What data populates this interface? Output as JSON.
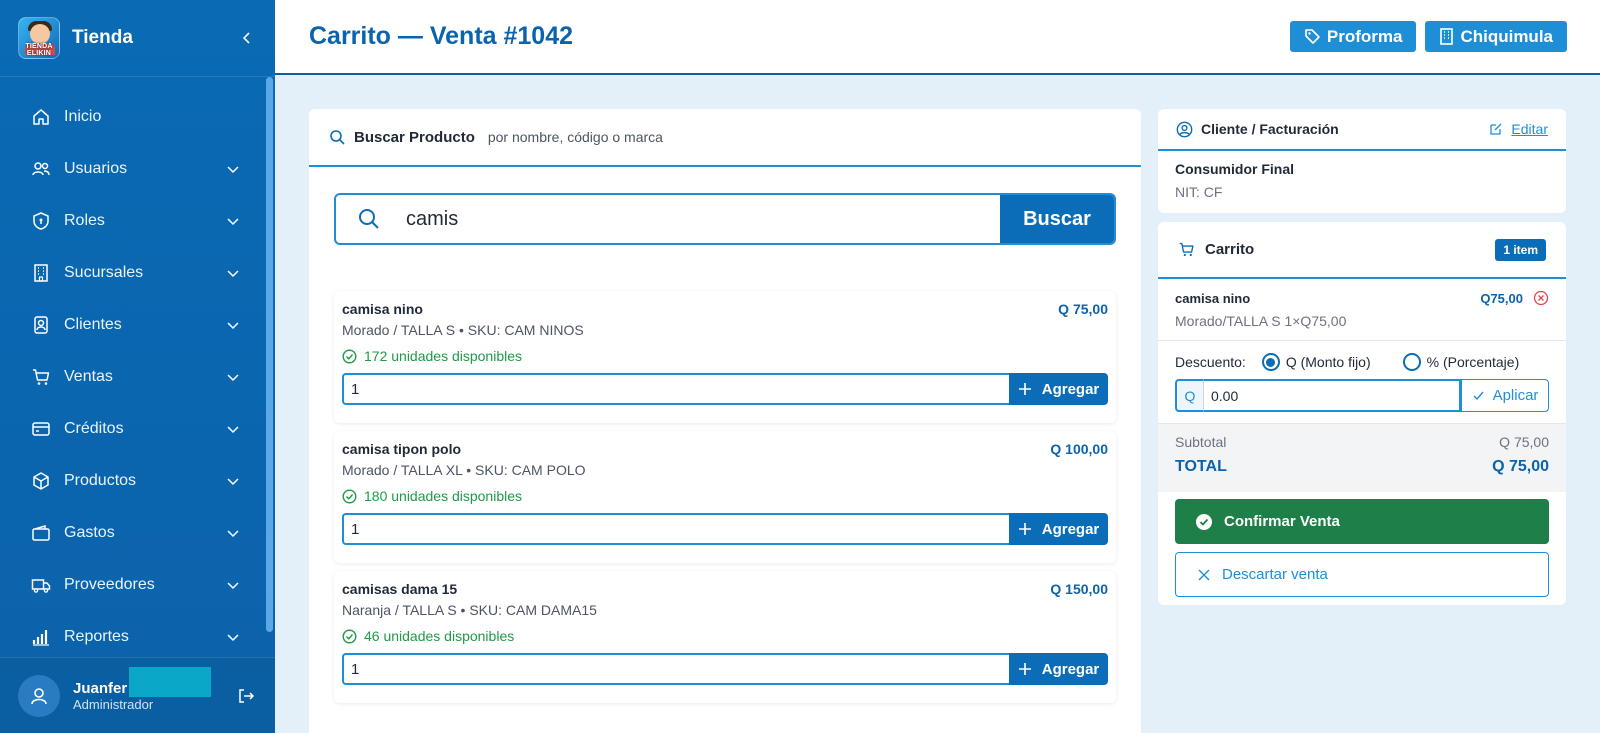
{
  "sidebar": {
    "brand": "Tienda",
    "logo_text": "TIENDA ELIKIN",
    "items": [
      {
        "label": "Inicio",
        "icon": "home-icon"
      },
      {
        "label": "Usuarios",
        "icon": "users-icon"
      },
      {
        "label": "Roles",
        "icon": "shield-icon"
      },
      {
        "label": "Sucursales",
        "icon": "building-icon"
      },
      {
        "label": "Clientes",
        "icon": "contact-icon"
      },
      {
        "label": "Ventas",
        "icon": "cart-icon"
      },
      {
        "label": "Créditos",
        "icon": "credit-card-icon"
      },
      {
        "label": "Productos",
        "icon": "box-icon"
      },
      {
        "label": "Gastos",
        "icon": "wallet-icon"
      },
      {
        "label": "Proveedores",
        "icon": "truck-icon"
      },
      {
        "label": "Reportes",
        "icon": "bar-chart-icon"
      }
    ],
    "user": {
      "name": "Juanfer",
      "role": "Administrador"
    }
  },
  "header": {
    "title": "Carrito — Venta #1042",
    "buttons": {
      "proforma": "Proforma",
      "branch": "Chiquimula"
    }
  },
  "search": {
    "title": "Buscar Producto",
    "subtitle": "por nombre, código o marca",
    "value": "camis",
    "button": "Buscar"
  },
  "products": [
    {
      "name": "camisa nino",
      "price": "Q 75,00",
      "meta": "Morado / TALLA S  • SKU: CAM NINOS",
      "stock": "172 unidades disponibles",
      "qty": "1",
      "add": "Agregar"
    },
    {
      "name": "camisa tipon polo",
      "price": "Q 100,00",
      "meta": "Morado / TALLA XL  • SKU: CAM POLO",
      "stock": "180 unidades disponibles",
      "qty": "1",
      "add": "Agregar"
    },
    {
      "name": "camisas dama 15",
      "price": "Q 150,00",
      "meta": "Naranja / TALLA S  • SKU: CAM DAMA15",
      "stock": "46 unidades disponibles",
      "qty": "1",
      "add": "Agregar"
    }
  ],
  "client": {
    "title": "Cliente / Facturación",
    "edit": "Editar",
    "name": "Consumidor Final",
    "nit": "NIT: CF"
  },
  "cart": {
    "title": "Carrito",
    "badge": "1 item",
    "item": {
      "name": "camisa nino",
      "price": "Q75,00",
      "meta": "Morado/TALLA S  1×Q75,00"
    },
    "discount": {
      "label": "Descuento:",
      "opt_fixed": "Q (Monto fijo)",
      "opt_pct": "% (Porcentaje)",
      "prefix": "Q",
      "value": "0.00",
      "apply": "Aplicar"
    },
    "subtotal_label": "Subtotal",
    "subtotal": "Q 75,00",
    "total_label": "TOTAL",
    "total": "Q 75,00",
    "confirm": "Confirmar Venta",
    "discard": "Descartar venta"
  },
  "colors": {
    "primary": "#0b6db8",
    "accent": "#1e8fd6",
    "success": "#1e8048",
    "danger": "#e0474c"
  }
}
